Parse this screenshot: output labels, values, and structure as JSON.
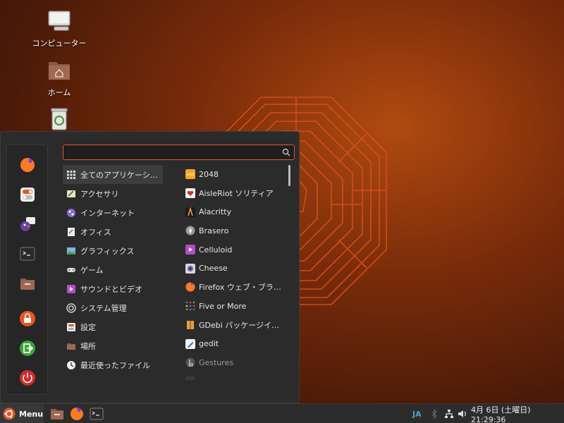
{
  "desktop": {
    "icons": [
      {
        "label": "コンピューター",
        "icon": "computer-icon"
      },
      {
        "label": "ホーム",
        "icon": "home-folder-icon"
      },
      {
        "label": "",
        "icon": "trash-icon"
      }
    ]
  },
  "menu": {
    "search": {
      "value": "",
      "placeholder": ""
    },
    "favorites": [
      "firefox-icon",
      "settings-toggle-icon",
      "pidgin-icon",
      "terminal-icon",
      "files-icon",
      "lock-icon",
      "logout-icon",
      "power-icon"
    ],
    "categories": [
      {
        "label": "全てのアプリケーシ…",
        "icon": "grid-icon"
      },
      {
        "label": "アクセサリ",
        "icon": "accessories-icon"
      },
      {
        "label": "インターネット",
        "icon": "internet-icon"
      },
      {
        "label": "オフィス",
        "icon": "office-icon"
      },
      {
        "label": "グラフィックス",
        "icon": "graphics-icon"
      },
      {
        "label": "ゲーム",
        "icon": "games-icon"
      },
      {
        "label": "サウンドとビデオ",
        "icon": "sound-video-icon"
      },
      {
        "label": "システム管理",
        "icon": "system-icon"
      },
      {
        "label": "設定",
        "icon": "preferences-icon"
      },
      {
        "label": "場所",
        "icon": "places-icon"
      },
      {
        "label": "最近使ったファイル",
        "icon": "recent-icon"
      }
    ],
    "apps": [
      {
        "label": "2048",
        "icon": "2048-icon",
        "color": "#f5a623"
      },
      {
        "label": "AisleRiot ソリティア",
        "icon": "aisleriot-icon",
        "color": "#f2f2f2"
      },
      {
        "label": "Alacritty",
        "icon": "alacritty-icon",
        "color": "#222222"
      },
      {
        "label": "Brasero",
        "icon": "brasero-icon",
        "color": "#9a9a9a"
      },
      {
        "label": "Celluloid",
        "icon": "celluloid-icon",
        "color": "#b04fc4"
      },
      {
        "label": "Cheese",
        "icon": "cheese-icon",
        "color": "#d8d8d8"
      },
      {
        "label": "Firefox ウェブ・ブラ…",
        "icon": "firefox-icon",
        "color": "#ff6a1a"
      },
      {
        "label": "Five or More",
        "icon": "five-or-more-icon",
        "color": "#3a7bd5"
      },
      {
        "label": "GDebi パッケージイ…",
        "icon": "gdebi-icon",
        "color": "#e8a040"
      },
      {
        "label": "gedit",
        "icon": "gedit-icon",
        "color": "#3b78c8"
      },
      {
        "label": "Gestures",
        "icon": "gestures-icon",
        "color": "#777777"
      },
      {
        "label": "",
        "icon": "next-app-icon",
        "color": "#555555"
      }
    ]
  },
  "panel": {
    "menu_label": "Menu",
    "launchers": [
      "files-icon",
      "firefox-icon",
      "terminal-icon"
    ],
    "input_method": "JA",
    "clock": "4月  6日 (土曜日) 21:29:36"
  },
  "colors": {
    "accent": "#e95420",
    "panel": "#2c2c2c",
    "menu_bg": "#2b2b2b"
  }
}
